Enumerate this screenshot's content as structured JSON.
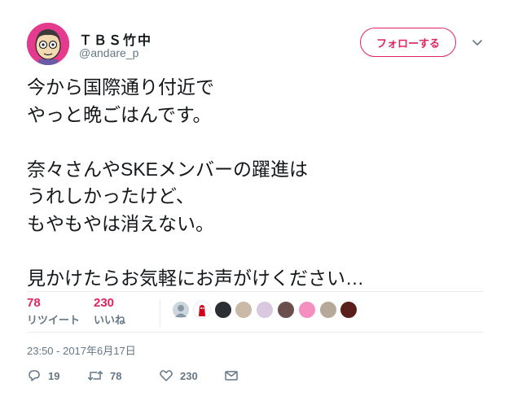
{
  "user": {
    "display_name": "ＴＢＳ竹中",
    "handle": "@andare_p"
  },
  "follow_button": {
    "label": "フォローする"
  },
  "tweet": {
    "lines": [
      "今から国際通り付近で",
      "やっと晩ごはんです。",
      "",
      "奈々さんやSKEメンバーの躍進は",
      "うれしかったけど、",
      "もやもやは消えない。",
      "",
      "見かけたらお気軽にお声がけください…"
    ]
  },
  "stats": {
    "retweets": {
      "count": "78",
      "label": "リツイート"
    },
    "likes": {
      "count": "230",
      "label": "いいね"
    }
  },
  "likers": [
    {
      "icon": "default-avatar",
      "color": "#ccd6dd"
    },
    {
      "icon": "red-character-avatar",
      "color": "#ffffff"
    },
    {
      "icon": "dark-avatar",
      "color": "#2b2f33"
    },
    {
      "icon": "photo-avatar",
      "color": "#c9b9a6"
    },
    {
      "icon": "photo-avatar",
      "color": "#d9c8e0"
    },
    {
      "icon": "photo-avatar",
      "color": "#6b4f4f"
    },
    {
      "icon": "pink-avatar",
      "color": "#f58fc0"
    },
    {
      "icon": "photo-avatar",
      "color": "#b7a99a"
    },
    {
      "icon": "photo-avatar",
      "color": "#5a1f1a"
    }
  ],
  "timestamp": "23:50 - 2017年6月17日",
  "actions": {
    "reply_count": "19",
    "retweet_count": "78",
    "like_count": "230"
  },
  "colors": {
    "accent": "#e0245e",
    "muted": "#657786",
    "divider": "#e6ecf0"
  }
}
